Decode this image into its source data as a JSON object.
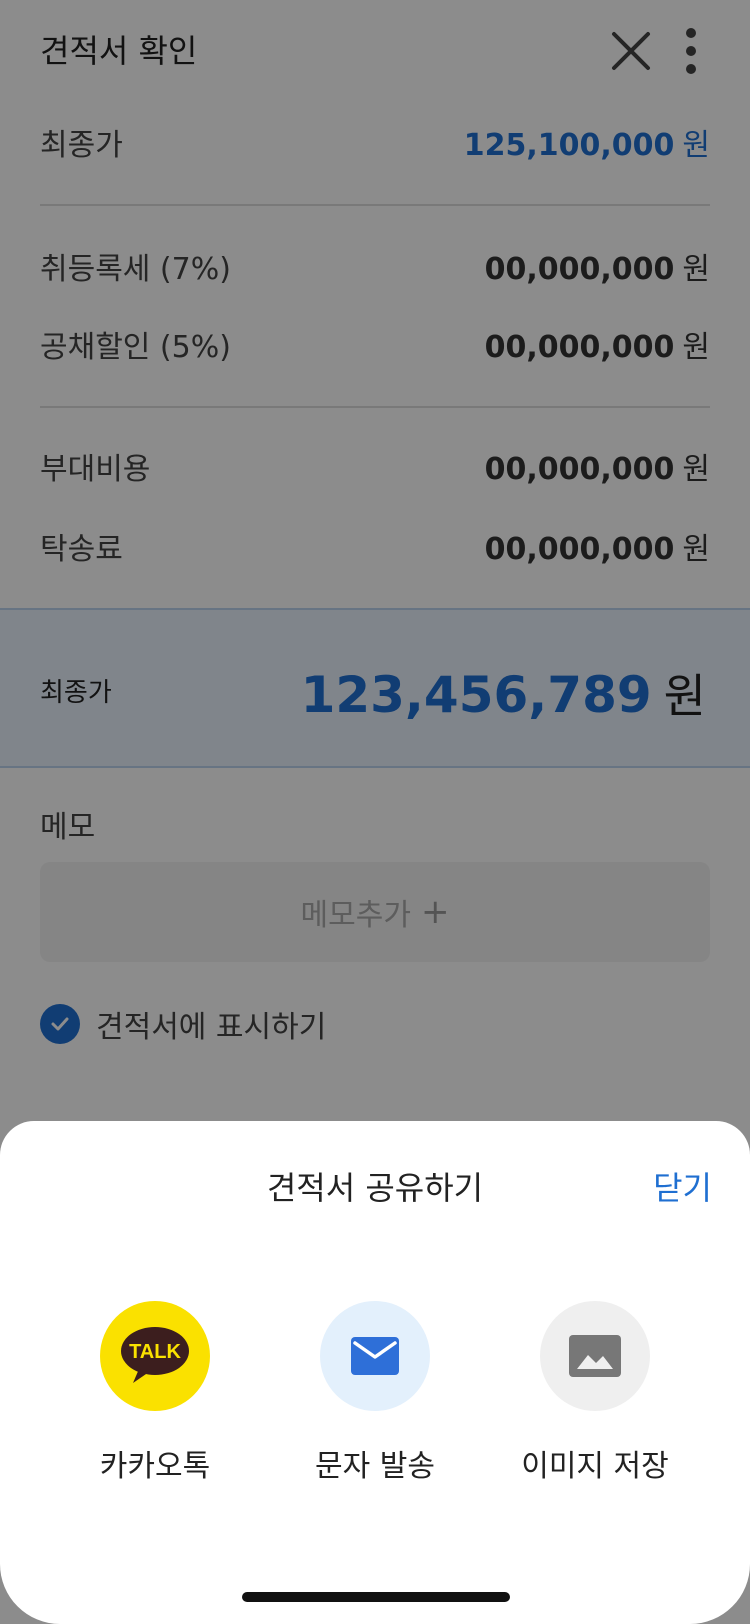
{
  "header": {
    "title": "견적서 확인",
    "close_icon": "close-icon",
    "more_icon": "more-vertical-icon"
  },
  "summary": {
    "label": "최종가",
    "amount": "125,100,000",
    "unit": "원"
  },
  "taxes": [
    {
      "label": "취등록세 (7%)",
      "amount": "00,000,000",
      "unit": "원"
    },
    {
      "label": "공채할인 (5%)",
      "amount": "00,000,000",
      "unit": "원"
    }
  ],
  "fees": [
    {
      "label": "부대비용",
      "amount": "00,000,000",
      "unit": "원"
    },
    {
      "label": "탁송료",
      "amount": "00,000,000",
      "unit": "원"
    }
  ],
  "total": {
    "label": "최종가",
    "amount": "123,456,789",
    "unit": "원"
  },
  "memo": {
    "label": "메모",
    "add_label": "메모추가",
    "add_icon": "+"
  },
  "display_option": {
    "label": "견적서에 표시하기",
    "checked": true
  },
  "share_sheet": {
    "title": "견적서 공유하기",
    "close_label": "닫기",
    "options": [
      {
        "label": "카카오톡",
        "icon": "kakaotalk-icon",
        "icon_text": "TALK",
        "bg": "#FAE100"
      },
      {
        "label": "문자 발송",
        "icon": "mail-icon",
        "bg": "#E3F0FC"
      },
      {
        "label": "이미지 저장",
        "icon": "image-icon",
        "bg": "#EFEFEF"
      }
    ]
  },
  "colors": {
    "accent": "#1F6FD1",
    "kakao_yellow": "#FAE100",
    "kakao_brown": "#3C1E1E"
  }
}
